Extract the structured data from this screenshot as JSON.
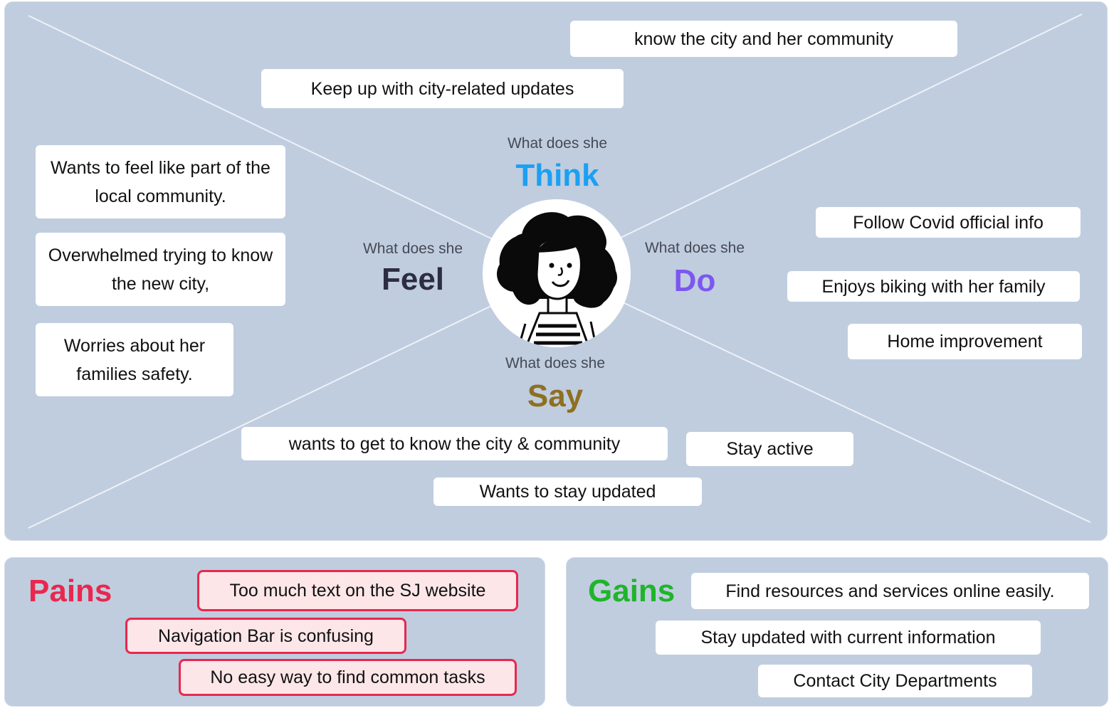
{
  "colors": {
    "panel": "#c0cddf",
    "think": "#1ba0f2",
    "feel": "#2d2d42",
    "do": "#7c57f0",
    "say": "#8d7022",
    "pains": "#e8284f",
    "gains": "#1fb52a"
  },
  "quadrants": {
    "question_prefix": "What does she",
    "think": "Think",
    "feel": "Feel",
    "do": "Do",
    "say": "Say"
  },
  "think_notes": [
    "know the city and her community",
    "Keep up with city-related updates"
  ],
  "feel_notes": [
    "Wants to feel like part of the local community.",
    "Overwhelmed trying to know the new city,",
    "Worries about her families safety."
  ],
  "do_notes": [
    "Follow Covid official info",
    "Enjoys biking with her family",
    "Home improvement"
  ],
  "say_notes": [
    "wants to get to know the city & community",
    "Stay active",
    "Wants to stay updated"
  ],
  "avatar_icon": "persona-avatar-icon",
  "pains": {
    "title": "Pains",
    "items": [
      "Too much text on the SJ website",
      "Navigation Bar is confusing",
      "No easy way to find common tasks"
    ]
  },
  "gains": {
    "title": "Gains",
    "items": [
      "Find resources and services online easily.",
      "Stay updated with current information",
      "Contact  City Departments"
    ]
  }
}
